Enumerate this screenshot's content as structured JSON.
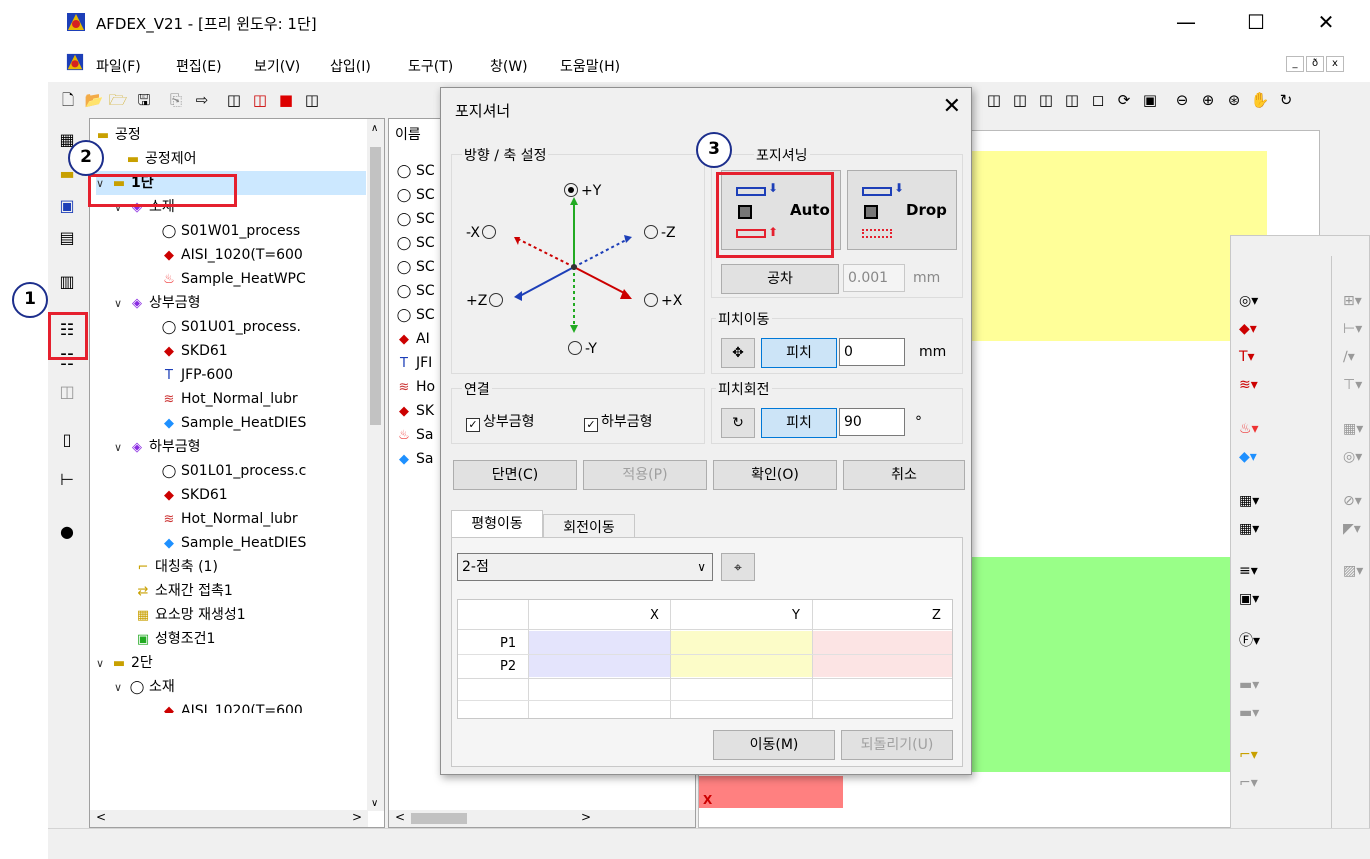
{
  "window": {
    "title": "AFDEX_V21 - [프리 윈도우: 1단]",
    "minimize": "—",
    "maximize": "☐",
    "close": "✕"
  },
  "menu": [
    "파일(F)",
    "편집(E)",
    "보기(V)",
    "삽입(I)",
    "도구(T)",
    "창(W)",
    "도움말(H)"
  ],
  "mdi_buttons": [
    "_",
    "ð",
    "x"
  ],
  "tree": {
    "header": "공정",
    "items": [
      {
        "label": "공정제어"
      },
      {
        "label": "1단"
      },
      {
        "label": "소재"
      },
      {
        "label": "S01W01_process"
      },
      {
        "label": "AISI_1020(T=600"
      },
      {
        "label": "Sample_HeatWPC"
      },
      {
        "label": "상부금형"
      },
      {
        "label": "S01U01_process."
      },
      {
        "label": "SKD61"
      },
      {
        "label": "JFP-600"
      },
      {
        "label": "Hot_Normal_lubr"
      },
      {
        "label": "Sample_HeatDIES"
      },
      {
        "label": "하부금형"
      },
      {
        "label": "S01L01_process.c"
      },
      {
        "label": "SKD61"
      },
      {
        "label": "Hot_Normal_lubr"
      },
      {
        "label": "Sample_HeatDIES"
      },
      {
        "label": "대칭축 (1)"
      },
      {
        "label": "소재간 접촉1"
      },
      {
        "label": "요소망 재생성1"
      },
      {
        "label": "성형조건1"
      },
      {
        "label": "2단"
      },
      {
        "label": "소재"
      },
      {
        "label": "AISI_1020(T=600"
      }
    ]
  },
  "list": {
    "header": "이름",
    "items": [
      "SC",
      "SC",
      "SC",
      "SC",
      "SC",
      "SC",
      "SC",
      "AI",
      "JFI",
      "Ho",
      "SK",
      "Sa",
      "Sa"
    ]
  },
  "dialog": {
    "title": "포지셔너",
    "close": "✕",
    "direction": {
      "label": "방향 / 축 설정",
      "axes": {
        "py": "+Y",
        "ny": "-Y",
        "px": "+X",
        "nx": "-X",
        "pz": "+Z",
        "nz": "-Z"
      },
      "selected": "+Y"
    },
    "positioning": {
      "label": "포지셔닝",
      "auto": "Auto",
      "drop": "Drop",
      "tolerance_label": "공차",
      "tolerance_value": "0.001",
      "tolerance_unit": "mm"
    },
    "pitch_move": {
      "label": "피치이동",
      "button": "피치",
      "value": "0",
      "unit": "mm"
    },
    "pitch_rotate": {
      "label": "피치회전",
      "button": "피치",
      "value": "90",
      "unit": "°"
    },
    "connection": {
      "label": "연결",
      "upper": "상부금형",
      "lower": "하부금형"
    },
    "buttons": {
      "section": "단면(C)",
      "apply": "적용(P)",
      "ok": "확인(O)",
      "cancel": "취소"
    },
    "tabs": {
      "translate": "평형이동",
      "rotate": "회전이동"
    },
    "method": "2-점",
    "table": {
      "headers": [
        "X",
        "Y",
        "Z"
      ],
      "rows": [
        "P1",
        "P2"
      ]
    },
    "move": "이동(M)",
    "undo": "되돌리기(U)"
  },
  "canvas_axis": "X",
  "callouts": [
    "1",
    "2",
    "3"
  ],
  "colors": {
    "yellow": "#ffff99",
    "green": "#99ff88",
    "red": "#ff8080",
    "callout": "#1c2e8c",
    "highlight": "#e5202e"
  }
}
